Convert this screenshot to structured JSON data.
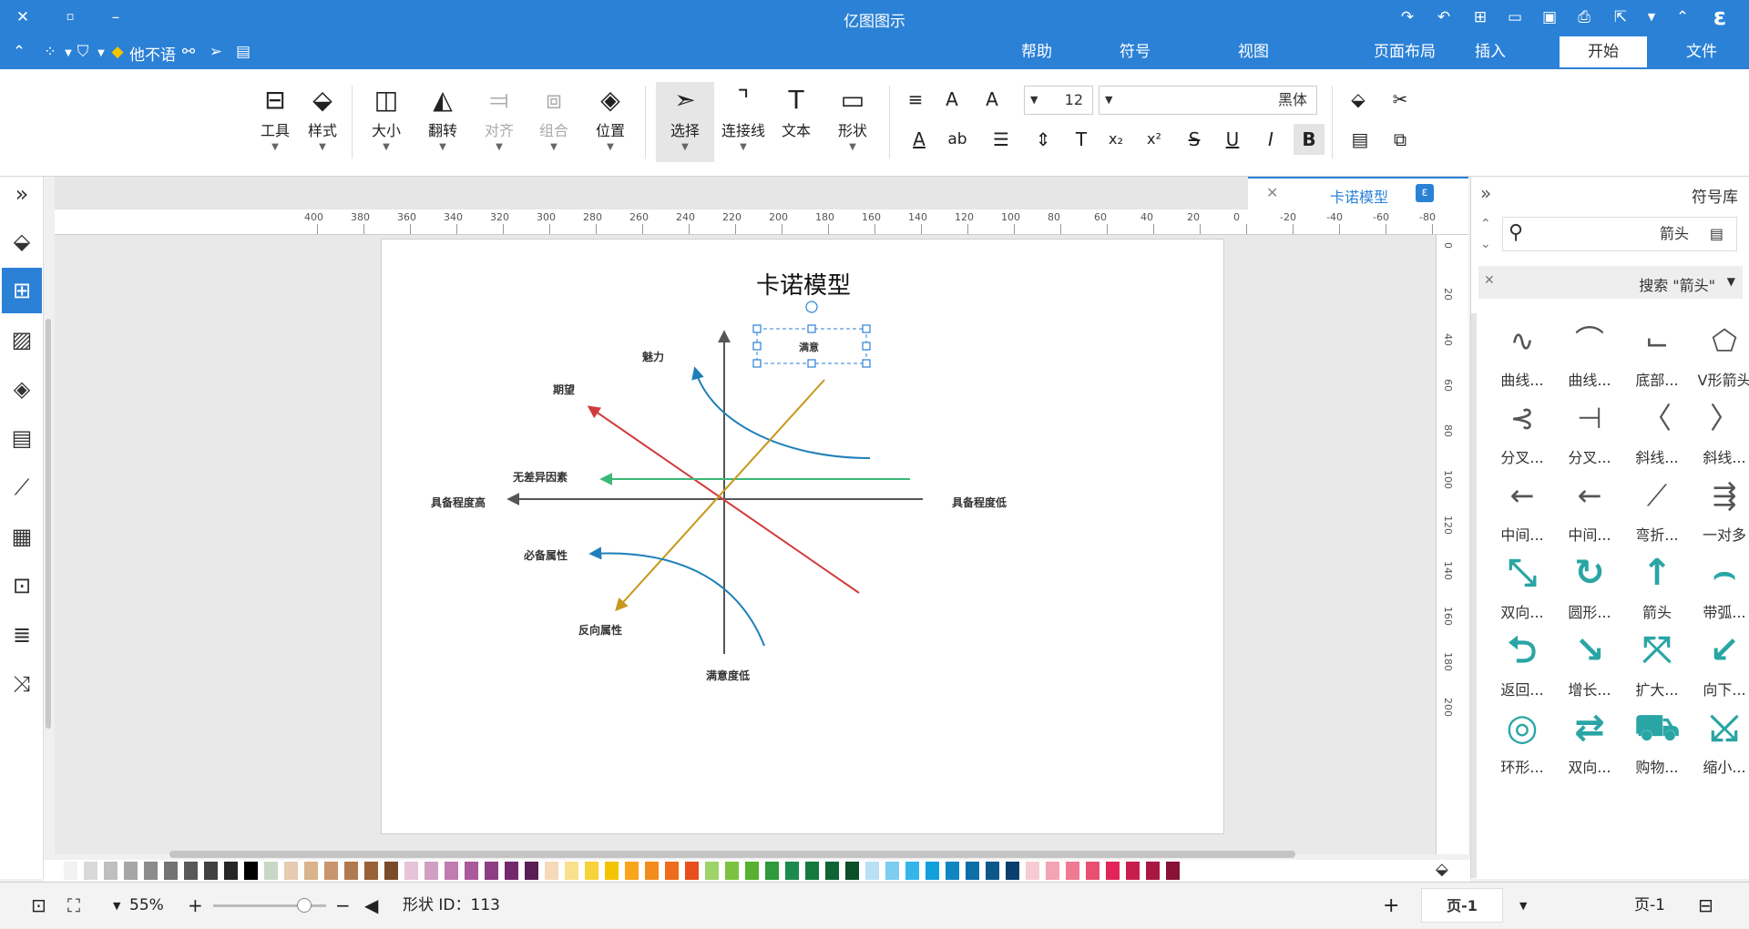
{
  "titlebar": {
    "title": "亿图图示"
  },
  "menu": {
    "tabs": [
      {
        "label": "文件",
        "active": false
      },
      {
        "label": "开始",
        "active": true
      },
      {
        "label": "插入",
        "active": false
      },
      {
        "label": "页面布局",
        "active": false
      },
      {
        "label": "视图",
        "active": false
      },
      {
        "label": "符号",
        "active": false
      },
      {
        "label": "帮助",
        "active": false
      }
    ],
    "user_label": "他不语"
  },
  "ribbon": {
    "font_name": "黑体",
    "font_size": "12",
    "buttons": [
      {
        "label": "形状",
        "icon": "rectangle-icon"
      },
      {
        "label": "文本",
        "icon": "text-tool-icon"
      },
      {
        "label": "连接线",
        "icon": "connector-icon"
      },
      {
        "label": "选择",
        "icon": "select-pointer-icon"
      },
      {
        "label": "位置",
        "icon": "layers-icon"
      },
      {
        "label": "组合",
        "icon": "group-icon"
      },
      {
        "label": "对齐",
        "icon": "align-icon"
      },
      {
        "label": "翻转",
        "icon": "flip-icon"
      },
      {
        "label": "大小",
        "icon": "size-icon"
      },
      {
        "label": "样式",
        "icon": "fill-style-icon"
      },
      {
        "label": "工具",
        "icon": "tools-icon"
      }
    ]
  },
  "document": {
    "tab_title": "卡诺模型"
  },
  "ruler": {
    "h_ticks": [
      "-80",
      "-60",
      "-40",
      "-20",
      "0",
      "20",
      "40",
      "60",
      "80",
      "100",
      "120",
      "140",
      "160",
      "180",
      "200",
      "220",
      "240",
      "260",
      "280",
      "300",
      "320",
      "340",
      "360",
      "380",
      "400"
    ],
    "v_ticks": [
      "0",
      "20",
      "40",
      "60",
      "80",
      "100",
      "120",
      "140",
      "160",
      "180",
      "200"
    ]
  },
  "diagram": {
    "title": "卡诺模型",
    "labels": {
      "satisfaction": "满意",
      "charm": "魅力",
      "expect": "期望",
      "indifferent": "无差异因素",
      "must": "必备属性",
      "reverse": "反向属性",
      "high_completeness": "具备程度高",
      "low_completeness": "具备程度低",
      "low_satisfaction": "满意度低"
    },
    "colors": {
      "charm": "#1f7fb8",
      "expect": "#d23b3b",
      "indifferent": "#3cb878",
      "reverse": "#c8961c",
      "axis": "#555555"
    }
  },
  "palette": {
    "colors": [
      "#ffffff",
      "#f2f2f2",
      "#d9d9d9",
      "#bfbfbf",
      "#a6a6a6",
      "#8c8c8c",
      "#737373",
      "#595959",
      "#404040",
      "#262626",
      "#000000",
      "#c9d8c5",
      "#e6cbb0",
      "#d9b38c",
      "#c8956c",
      "#b07a4f",
      "#9a6036",
      "#7a4a2a",
      "#e6c3d9",
      "#d19fc2",
      "#c07bb0",
      "#a85a9a",
      "#8e3c84",
      "#722a6c",
      "#5a1e56",
      "#f5d9b8",
      "#f9e08a",
      "#f7d23a",
      "#f5c400",
      "#f8a51c",
      "#f28c1c",
      "#ef6c1c",
      "#e84f1c",
      "#9ed36a",
      "#7cc242",
      "#57b030",
      "#2f9a3c",
      "#1b8a4c",
      "#14793f",
      "#0f6433",
      "#0a4f28",
      "#b9e0f5",
      "#7ccdf0",
      "#35b5ea",
      "#12a0dd",
      "#0f86c2",
      "#0c6ea6",
      "#0a578a",
      "#083f6e",
      "#f7cbd2",
      "#f4a3b2",
      "#ef7a92",
      "#e94f72",
      "#e3245a",
      "#c81e4e",
      "#a81842",
      "#881236"
    ]
  },
  "symbols": {
    "panel_title": "符号库",
    "search_value": "箭头",
    "result_title": "搜索 \"箭头\"",
    "items": [
      {
        "name": "V形箭头",
        "icon": "v-arrow-icon"
      },
      {
        "name": "底部...",
        "icon": "bottom-arrow-icon"
      },
      {
        "name": "曲线...",
        "icon": "curve-arrow-icon"
      },
      {
        "name": "曲线...",
        "icon": "wave-arrow-icon"
      },
      {
        "name": "斜线...",
        "icon": "diagonal-arrow-icon"
      },
      {
        "name": "斜线...",
        "icon": "diagonal-arrow-2-icon"
      },
      {
        "name": "分叉...",
        "icon": "fork-arrow-icon"
      },
      {
        "name": "分叉...",
        "icon": "fork-arrow-2-icon"
      },
      {
        "name": "一对多",
        "icon": "one-to-many-icon"
      },
      {
        "name": "弯折...",
        "icon": "bent-arrow-icon"
      },
      {
        "name": "中间...",
        "icon": "middle-arrow-icon"
      },
      {
        "name": "中间...",
        "icon": "middle-arrow-2-icon"
      },
      {
        "name": "带弧...",
        "icon": "arc-arrow-icon"
      },
      {
        "name": "箭头",
        "icon": "up-arrow-icon"
      },
      {
        "name": "圆形...",
        "icon": "circular-arrow-icon"
      },
      {
        "name": "双向...",
        "icon": "double-arrow-icon"
      },
      {
        "name": "向下...",
        "icon": "down-arrow-icon"
      },
      {
        "name": "扩大...",
        "icon": "expand-arrow-icon"
      },
      {
        "name": "增长...",
        "icon": "growth-arrow-icon"
      },
      {
        "name": "返回...",
        "icon": "return-arrow-icon"
      },
      {
        "name": "缩小...",
        "icon": "shrink-arrow-icon"
      },
      {
        "name": "购物...",
        "icon": "cart-arrow-icon"
      },
      {
        "name": "双向...",
        "icon": "swap-arrow-icon"
      },
      {
        "name": "环形...",
        "icon": "ring-arrow-icon"
      }
    ]
  },
  "status": {
    "page_tab": "页-1",
    "page_select": "页-1",
    "shape_id": "形状 ID：113",
    "zoom": "55%"
  }
}
